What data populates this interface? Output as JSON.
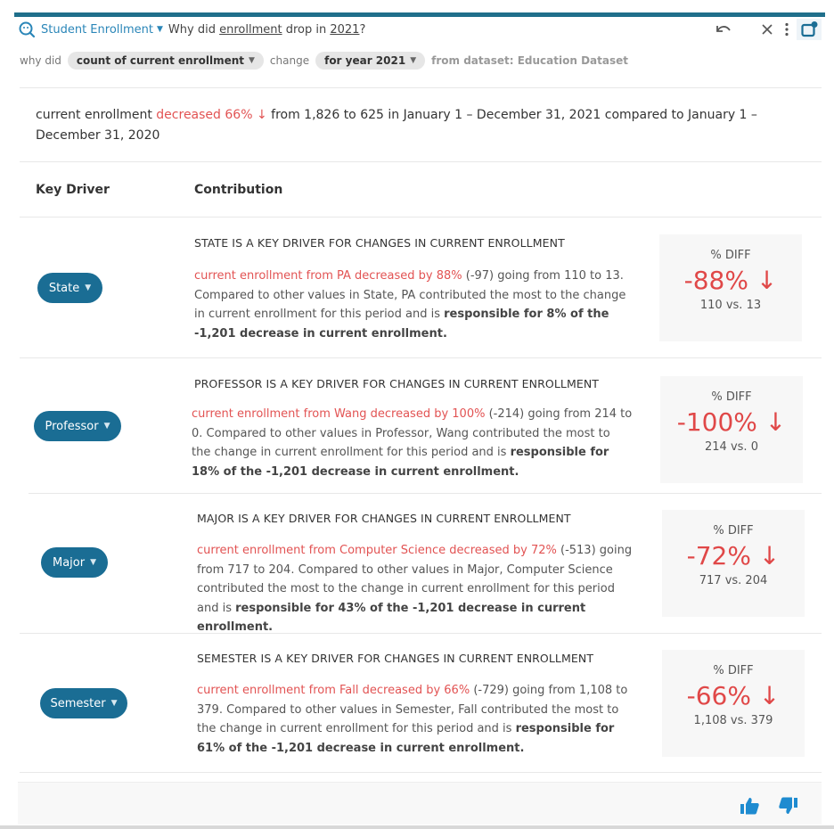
{
  "header": {
    "app_title": "Student Enrollment",
    "question_prefix": "Why did ",
    "question_term1": "enrollment",
    "question_mid": " drop in ",
    "question_term2": "2021",
    "question_suffix": "?",
    "icons": [
      "search-icon",
      "undo-icon",
      "close-icon",
      "more-vertical-icon",
      "pin-icon"
    ]
  },
  "subbar": {
    "why_did_label": "why did",
    "metric_chip": "count of current enrollment",
    "change_label": "change",
    "period_chip": "for year 2021",
    "dataset_label": "from dataset: Education Dataset"
  },
  "summary": {
    "prefix": "current enrollment ",
    "change": "decreased 66% ↓",
    "suffix": " from 1,826 to 625 in January 1 – December 31, 2021 compared to January 1 – December 31, 2020"
  },
  "columns": {
    "key_driver": "Key Driver",
    "contribution": "Contribution"
  },
  "drivers": [
    {
      "pill": "State",
      "heading": "STATE IS A KEY DRIVER FOR CHANGES IN CURRENT ENROLLMENT",
      "highlight": "current enrollment from PA decreased by 88%",
      "text": " (-97) going from 110 to 13. Compared to other values in State, PA contributed the most to the change in current enrollment for this period and is ",
      "bold": "responsible for 8% of the -1,201 decrease in current enrollment.",
      "diff_label": "% DIFF",
      "diff_value": "-88% ↓",
      "comparison": "110 vs. 13"
    },
    {
      "pill": "Professor",
      "heading": "PROFESSOR IS A KEY DRIVER FOR CHANGES IN CURRENT ENROLLMENT",
      "highlight": "current enrollment from Wang decreased by 100%",
      "text": " (-214) going from 214 to 0. Compared to other values in Professor, Wang contributed the most to the change in current enrollment for this period and is ",
      "bold": "responsible for 18% of the -1,201 decrease in current enrollment.",
      "diff_label": "% DIFF",
      "diff_value": "-100% ↓",
      "comparison": "214 vs. 0"
    },
    {
      "pill": "Major",
      "heading": "MAJOR IS A KEY DRIVER FOR CHANGES IN CURRENT ENROLLMENT",
      "highlight": "current enrollment from Computer Science decreased by 72%",
      "text": " (-513) going from 717 to 204. Compared to other values in Major, Computer Science contributed the most to the change in current enrollment for this period and is ",
      "bold": "responsible for 43% of the -1,201 decrease in current enrollment.",
      "diff_label": "% DIFF",
      "diff_value": "-72% ↓",
      "comparison": "717 vs. 204"
    },
    {
      "pill": "Semester",
      "heading": "SEMESTER IS A KEY DRIVER FOR CHANGES IN CURRENT ENROLLMENT",
      "highlight": "current enrollment from Fall decreased by 66%",
      "text": " (-729) going from 1,108 to 379. Compared to other values in Semester, Fall contributed the most to the change in current enrollment for this period and is ",
      "bold": "responsible for 61% of the -1,201 decrease in current enrollment.",
      "diff_label": "% DIFF",
      "diff_value": "-66% ↓",
      "comparison": "1,108 vs. 379"
    }
  ],
  "footer": {
    "icons": [
      "thumbs-up-icon",
      "thumbs-down-icon"
    ]
  },
  "colors": {
    "accent": "#1f6f8b",
    "pill": "#1a6d94",
    "link": "#2a86b8",
    "negative": "#e04848",
    "feedback": "#1e8bd0"
  }
}
